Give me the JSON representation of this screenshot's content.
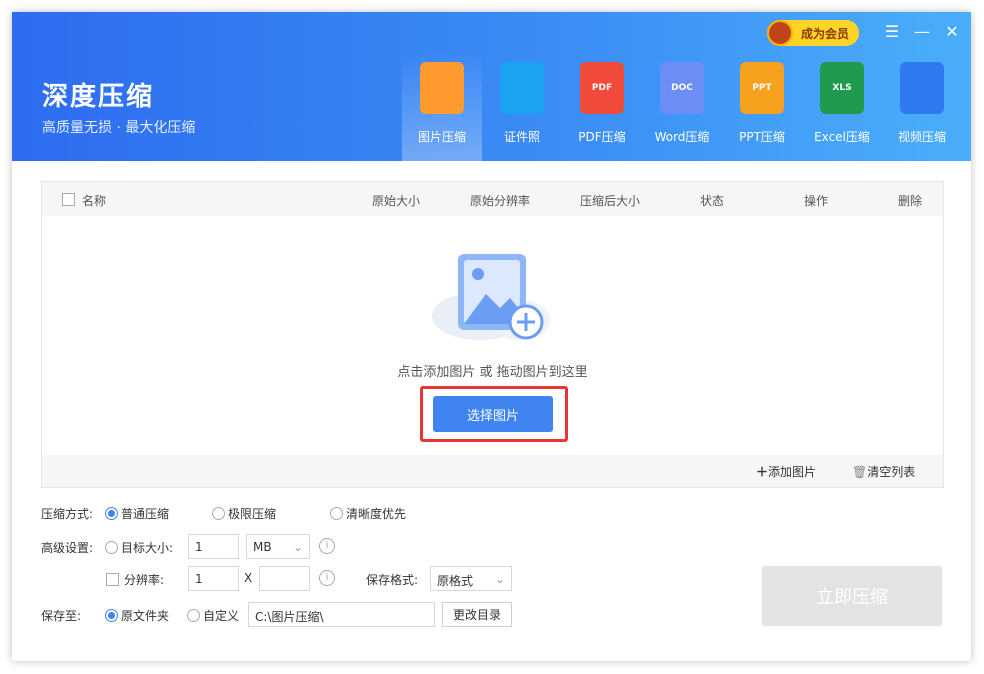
{
  "app": {
    "title": "深度压缩",
    "slogan": "高质量无损 · 最大化压缩",
    "vip": "成为会员"
  },
  "window_controls": {
    "menu": "☰",
    "minimize": "—",
    "close": "✕"
  },
  "tabs": [
    {
      "label": "图片压缩",
      "icon": "image",
      "color": "#ff9a2e",
      "badge": ""
    },
    {
      "label": "证件照",
      "icon": "id-photo",
      "color": "#1aa3f0",
      "badge": ""
    },
    {
      "label": "PDF压缩",
      "icon": "pdf",
      "color": "#ef4a3a",
      "badge": "PDF"
    },
    {
      "label": "Word压缩",
      "icon": "word",
      "color": "#6d8ff5",
      "badge": "DOC"
    },
    {
      "label": "PPT压缩",
      "icon": "ppt",
      "color": "#f7a21e",
      "badge": "PPT"
    },
    {
      "label": "Excel压缩",
      "icon": "excel",
      "color": "#1f9a4e",
      "badge": "XLS"
    },
    {
      "label": "视频压缩",
      "icon": "video",
      "color": "#2f7af0",
      "badge": ""
    }
  ],
  "table": {
    "columns": [
      "名称",
      "原始大小",
      "原始分辨率",
      "压缩后大小",
      "状态",
      "操作",
      "删除"
    ]
  },
  "dropzone": {
    "hint": "点击添加图片 或 拖动图片到这里",
    "button": "选择图片"
  },
  "footer": {
    "add": "添加图片",
    "clear": "清空列表"
  },
  "settings": {
    "mode_label": "压缩方式:",
    "modes": [
      "普通压缩",
      "极限压缩",
      "清晰度优先"
    ],
    "adv_label": "高级设置:",
    "target_label": "目标大小:",
    "target_value": "1",
    "target_unit": "MB",
    "res_label": "分辨率:",
    "res_w": "1",
    "res_x": "X",
    "res_h": "",
    "format_label": "保存格式:",
    "format_value": "原格式",
    "save_label": "保存至:",
    "save_opts": [
      "原文件夹",
      "自定义"
    ],
    "save_path": "C:\\图片压缩\\",
    "change_dir": "更改目录"
  },
  "start": "立即压缩"
}
